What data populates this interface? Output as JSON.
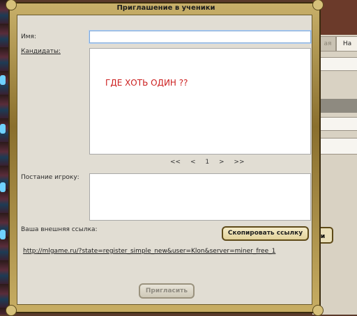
{
  "dialog": {
    "title": "Приглашение в ученики",
    "name_label": "Имя:",
    "name_value": "",
    "candidates_label": "Кандидаты:",
    "candidates_empty_text": "ГДЕ ХОТЬ ОДИН ??",
    "pager": {
      "first": "<<",
      "prev": "<",
      "page": "1",
      "next": ">",
      "last": ">>"
    },
    "message_label": "Постание игроку:",
    "message_value": "",
    "external_link_label": "Ваша внешняя ссылка:",
    "copy_button": "Скопировать ссылку",
    "external_link": "http://mlgame.ru/?state=register_simple_new&user=Klon&server=miner_free_1",
    "invite_button": "Пригласить"
  },
  "background": {
    "tab_1": "ая",
    "tab_2": "На",
    "side_button": "и"
  }
}
